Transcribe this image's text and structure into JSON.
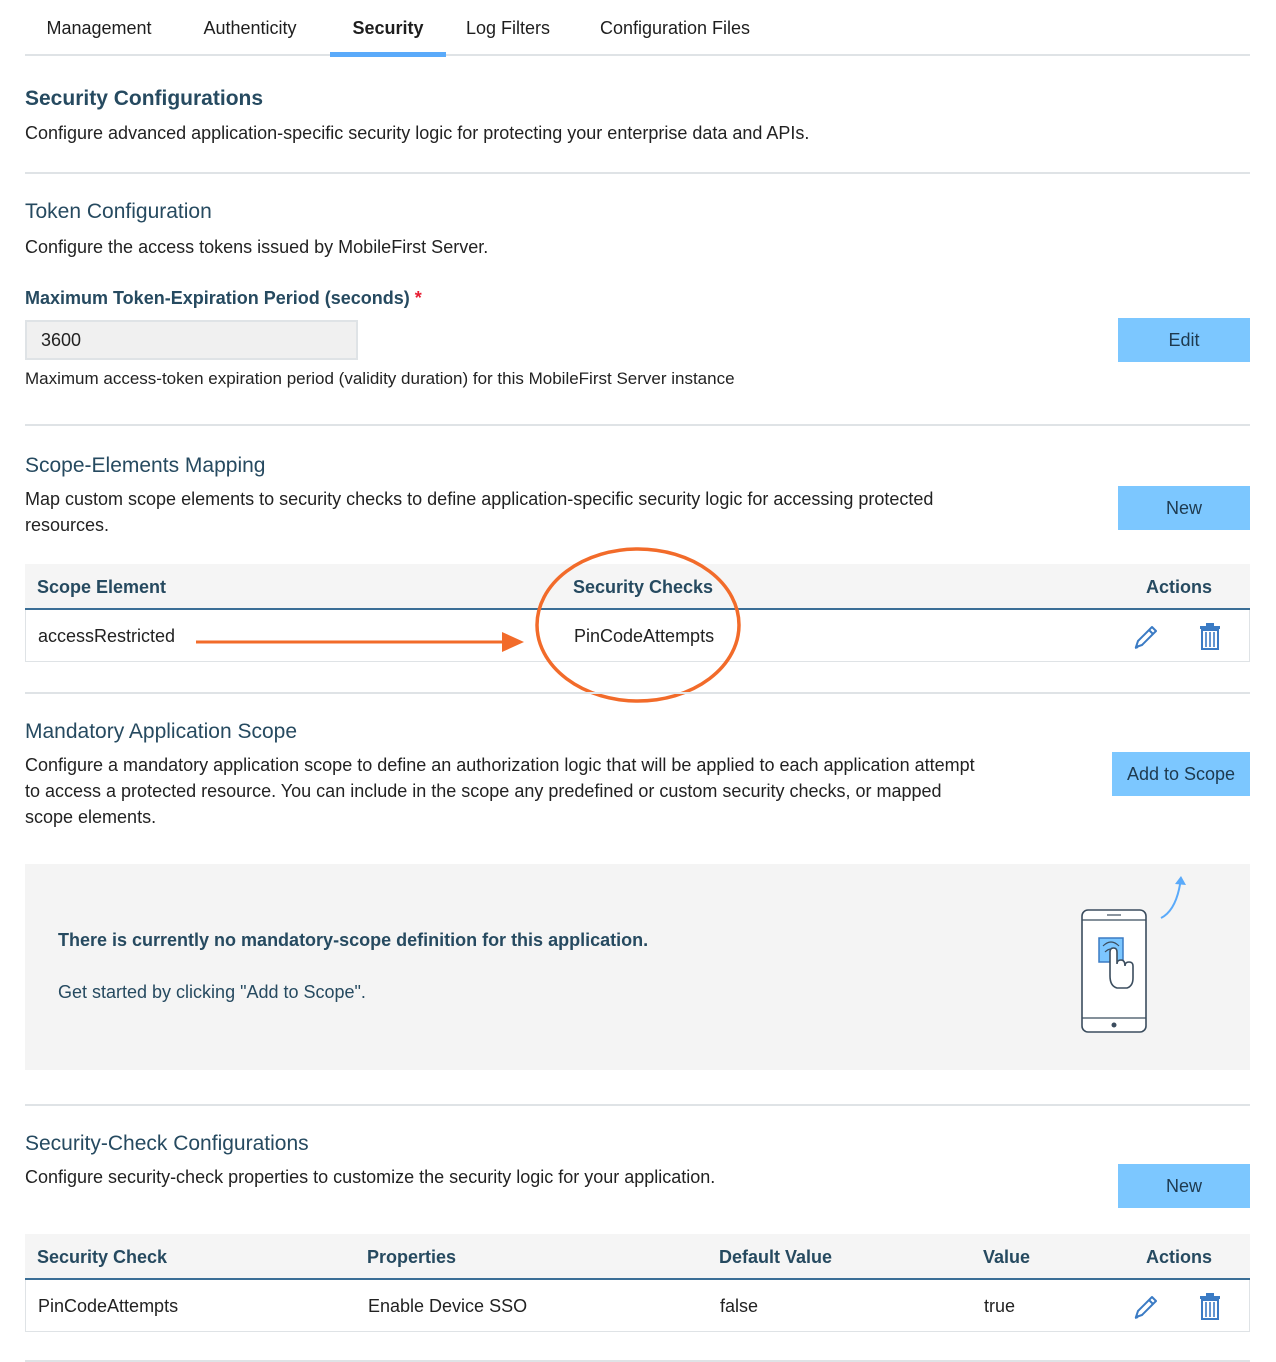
{
  "tabs": [
    {
      "label": "Management"
    },
    {
      "label": "Authenticity"
    },
    {
      "label": "Security"
    },
    {
      "label": "Log Filters"
    },
    {
      "label": "Configuration Files"
    }
  ],
  "security": {
    "title": "Security Configurations",
    "description": "Configure advanced application-specific security logic for protecting your enterprise data and APIs."
  },
  "token": {
    "title": "Token Configuration",
    "description": "Configure the access tokens issued by MobileFirst Server.",
    "field_label": "Maximum Token-Expiration Period (seconds)",
    "required_mark": "*",
    "value": "3600",
    "help": "Maximum access-token expiration period (validity duration) for this MobileFirst Server instance",
    "edit_label": "Edit"
  },
  "scope_mapping": {
    "title": "Scope-Elements Mapping",
    "description_line1": "Map custom scope elements to security checks to define application-specific security logic for accessing protected",
    "description_line2": "resources.",
    "new_label": "New",
    "columns": [
      "Scope Element",
      "Security Checks",
      "Actions"
    ],
    "rows": [
      {
        "scope_element": "accessRestricted",
        "security_checks": "PinCodeAttempts"
      }
    ]
  },
  "mandatory_scope": {
    "title": "Mandatory Application Scope",
    "description_line1": "Configure a mandatory application scope to define an authorization logic that will be applied to each application attempt",
    "description_line2": "to access a protected resource. You can include in the scope any predefined or custom security checks, or mapped",
    "description_line3": "scope elements.",
    "add_label": "Add to Scope",
    "empty_title": "There is currently no mandatory-scope definition for this application.",
    "empty_hint": "Get started by clicking \"Add to Scope\"."
  },
  "check_config": {
    "title": "Security-Check Configurations",
    "description": "Configure security-check properties to customize the security logic for your application.",
    "new_label": "New",
    "columns": [
      "Security Check",
      "Properties",
      "Default Value",
      "Value",
      "Actions"
    ],
    "rows": [
      {
        "security_check": "PinCodeAttempts",
        "properties": "Enable Device SSO",
        "default_value": "false",
        "value": "true"
      }
    ]
  },
  "colors": {
    "accent": "#5aaafa",
    "button": "#7cc7ff",
    "heading": "#264a60",
    "annotation": "#f26b2a",
    "icon": "#3b7bc4"
  },
  "icons": [
    "pencil-icon",
    "trash-icon",
    "phone-touch-icon",
    "arrow-annotation",
    "circle-annotation"
  ]
}
